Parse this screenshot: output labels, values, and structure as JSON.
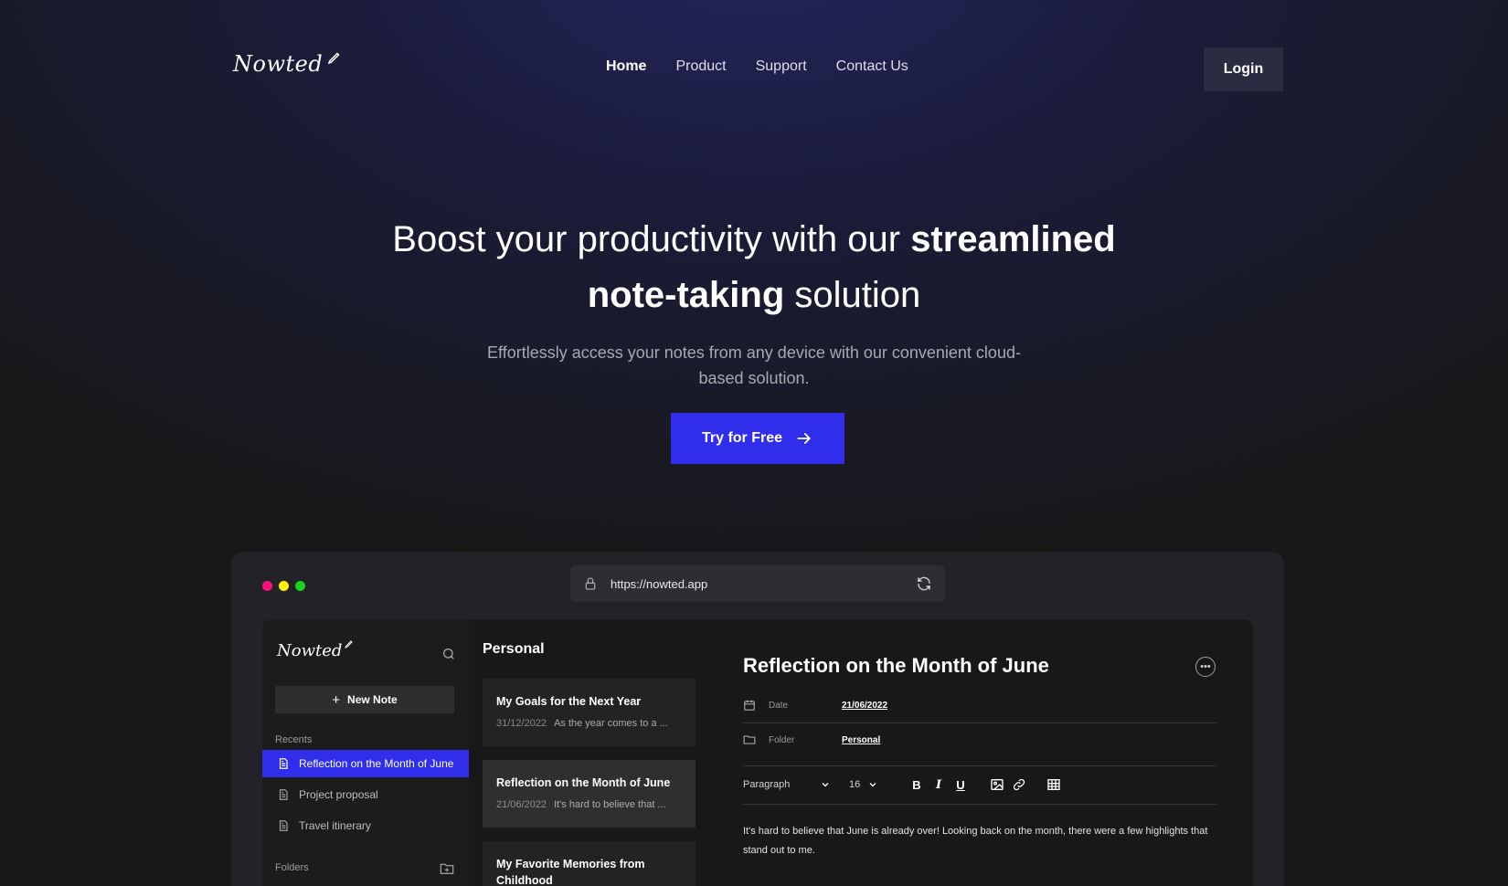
{
  "nav": {
    "logo": "Nowted",
    "links": [
      "Home",
      "Product",
      "Support",
      "Contact Us"
    ],
    "login": "Login"
  },
  "hero": {
    "title_part1": "Boost your productivity with our ",
    "title_bold1": "streamlined",
    "title_bold2": "note-taking",
    "title_part2": " solution",
    "subtitle": "Effortlessly access your notes from any device with our convenient cloud-based solution.",
    "cta": "Try for Free"
  },
  "browser": {
    "url": "https://nowted.app",
    "dot_colors": [
      "#ff0f7b",
      "#fff200",
      "#19d41c"
    ]
  },
  "app": {
    "logo": "Nowted",
    "new_note": "New Note",
    "recents_label": "Recents",
    "recents": [
      "Reflection on the Month of June",
      "Project proposal",
      "Travel itinerary"
    ],
    "folders_label": "Folders",
    "list_title": "Personal",
    "notes": [
      {
        "title": "My Goals for the Next Year",
        "date": "31/12/2022",
        "preview": "As the year comes to a ..."
      },
      {
        "title": "Reflection on the Month of June",
        "date": "21/06/2022",
        "preview": "It's hard to believe that ..."
      },
      {
        "title": "My Favorite Memories from Childhood",
        "date": "",
        "preview": ""
      }
    ],
    "editor": {
      "title": "Reflection on the Month of June",
      "date_label": "Date",
      "date_value": "21/06/2022",
      "folder_label": "Folder",
      "folder_value": "Personal",
      "paragraph": "Paragraph",
      "font_size": "16",
      "body": "It's hard to believe that June is already over! Looking back on the month, there were a few highlights that stand out to me."
    }
  },
  "colors": {
    "accent": "#312eeb"
  }
}
